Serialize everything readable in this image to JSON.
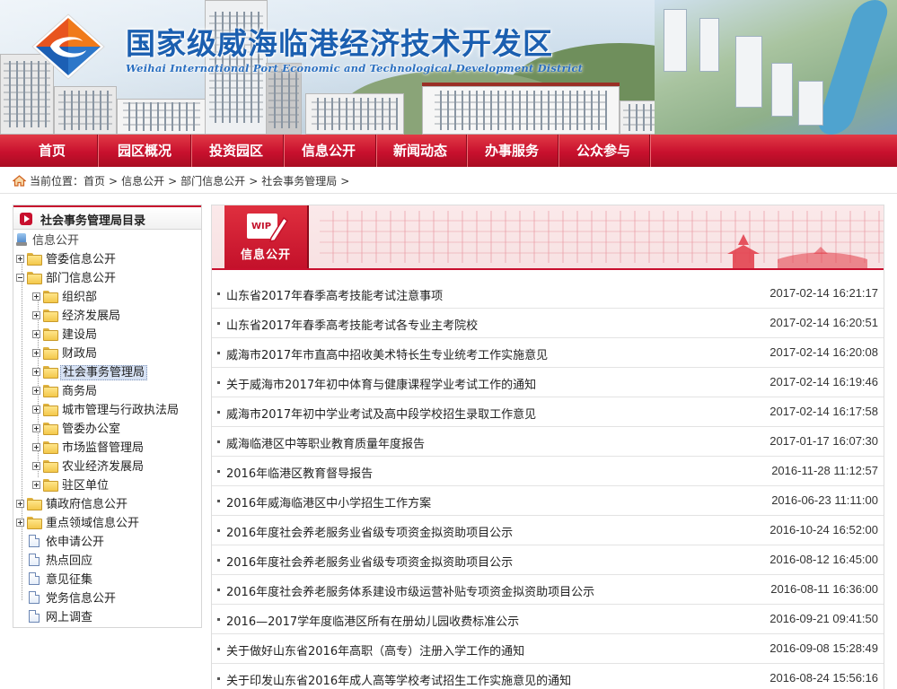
{
  "header": {
    "title": "国家级威海临港经济技术开发区",
    "subtitle": "Weihai International Port Economic and Technological Development District"
  },
  "nav": [
    {
      "label": "首页"
    },
    {
      "label": "园区概况"
    },
    {
      "label": "投资园区"
    },
    {
      "label": "信息公开"
    },
    {
      "label": "新闻动态"
    },
    {
      "label": "办事服务"
    },
    {
      "label": "公众参与"
    }
  ],
  "breadcrumb": {
    "prefix": "当前位置：",
    "items": [
      "首页",
      "信息公开",
      "部门信息公开",
      "社会事务管理局"
    ],
    "separator": ">"
  },
  "sidebar": {
    "title": "社会事务管理局目录",
    "root": "信息公开",
    "nodes": [
      {
        "label": "管委信息公开",
        "icon": "folder-icon"
      },
      {
        "label": "部门信息公开",
        "icon": "folder-open-icon"
      },
      {
        "label": "组织部",
        "icon": "folder-icon"
      },
      {
        "label": "经济发展局",
        "icon": "folder-icon"
      },
      {
        "label": "建设局",
        "icon": "folder-icon"
      },
      {
        "label": "财政局",
        "icon": "folder-icon"
      },
      {
        "label": "社会事务管理局",
        "icon": "folder-icon",
        "selected": true
      },
      {
        "label": "商务局",
        "icon": "folder-icon"
      },
      {
        "label": "城市管理与行政执法局",
        "icon": "folder-icon"
      },
      {
        "label": "管委办公室",
        "icon": "folder-icon"
      },
      {
        "label": "市场监督管理局",
        "icon": "folder-icon"
      },
      {
        "label": "农业经济发展局",
        "icon": "folder-icon"
      },
      {
        "label": "驻区单位",
        "icon": "folder-icon"
      },
      {
        "label": "镇政府信息公开",
        "icon": "folder-icon"
      },
      {
        "label": "重点领域信息公开",
        "icon": "folder-icon"
      },
      {
        "label": "依申请公开",
        "icon": "document-icon"
      },
      {
        "label": "热点回应",
        "icon": "document-icon"
      },
      {
        "label": "意见征集",
        "icon": "document-icon"
      },
      {
        "label": "党务信息公开",
        "icon": "document-icon"
      },
      {
        "label": "网上调查",
        "icon": "document-icon"
      }
    ]
  },
  "main": {
    "section_label": "信息公开",
    "badge_icon_text": "WIP",
    "items": [
      {
        "title": "山东省2017年春季高考技能考试注意事项",
        "date": "2017-02-14 16:21:17"
      },
      {
        "title": "山东省2017年春季高考技能考试各专业主考院校",
        "date": "2017-02-14 16:20:51"
      },
      {
        "title": "威海市2017年市直高中招收美术特长生专业统考工作实施意见",
        "date": "2017-02-14 16:20:08"
      },
      {
        "title": "关于威海市2017年初中体育与健康课程学业考试工作的通知",
        "date": "2017-02-14 16:19:46"
      },
      {
        "title": "威海市2017年初中学业考试及高中段学校招生录取工作意见",
        "date": "2017-02-14 16:17:58"
      },
      {
        "title": "威海临港区中等职业教育质量年度报告",
        "date": "2017-01-17 16:07:30"
      },
      {
        "title": "2016年临港区教育督导报告",
        "date": "2016-11-28 11:12:57"
      },
      {
        "title": "2016年威海临港区中小学招生工作方案",
        "date": "2016-06-23 11:11:00"
      },
      {
        "title": "2016年度社会养老服务业省级专项资金拟资助项目公示",
        "date": "2016-10-24 16:52:00"
      },
      {
        "title": "2016年度社会养老服务业省级专项资金拟资助项目公示",
        "date": "2016-08-12 16:45:00"
      },
      {
        "title": "2016年度社会养老服务体系建设市级运营补贴专项资金拟资助项目公示",
        "date": "2016-08-11 16:36:00"
      },
      {
        "title": "2016—2017学年度临港区所有在册幼儿园收费标准公示",
        "date": "2016-09-21 09:41:50"
      },
      {
        "title": "关于做好山东省2016年高职（高专）注册入学工作的通知",
        "date": "2016-09-08 15:28:49"
      },
      {
        "title": "关于印发山东省2016年成人高等学校考试招生工作实施意见的通知",
        "date": "2016-08-24 15:56:16"
      }
    ]
  },
  "colors": {
    "brand_red": "#c8102e",
    "title_blue": "#1b5fb0"
  }
}
